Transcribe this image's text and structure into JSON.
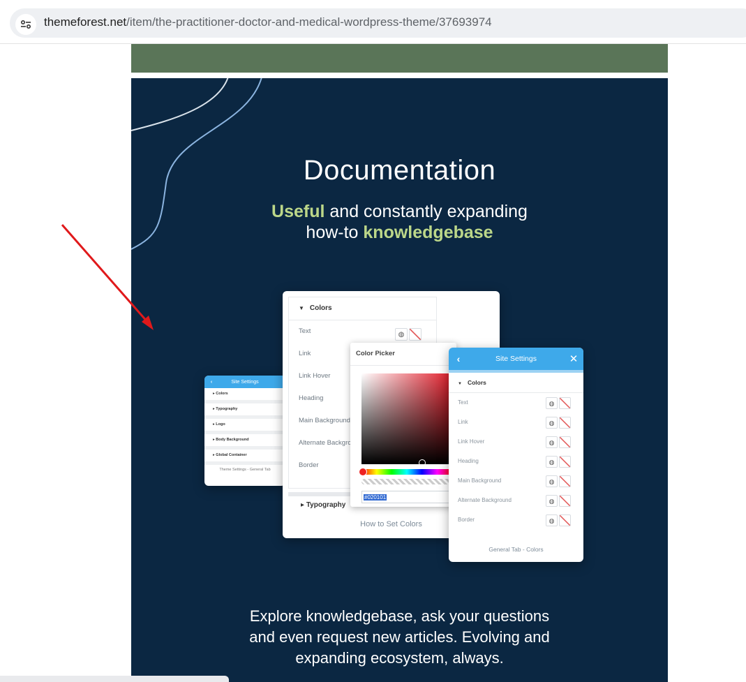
{
  "browser": {
    "url_domain": "themeforest.net",
    "url_path": "/item/the-practitioner-doctor-and-medical-wordpress-theme/37693974",
    "site_icon": "tune-icon"
  },
  "hero": {
    "title": "Documentation",
    "subtitle_hl1": "Useful",
    "subtitle_mid": " and constantly expanding",
    "subtitle_prefix2": "how-to ",
    "subtitle_hl2": "knowledgebase",
    "body_line1": "Explore knowledgebase, ask your questions",
    "body_line2": "and even request new articles. Evolving and",
    "body_line3": "expanding ecosystem, always."
  },
  "small_card": {
    "title": "Site Settings",
    "items": [
      "Colors",
      "Typography",
      "Logo",
      "Body Background",
      "Global Container"
    ],
    "footer": "Theme Settings - General Tab"
  },
  "main_card": {
    "section": "Colors",
    "options": [
      "Text",
      "Link",
      "Link Hover",
      "Heading",
      "Main Background",
      "Alternate Backgro",
      "Border"
    ],
    "typography": "Typography",
    "footer": "How to Set Colors"
  },
  "picker": {
    "title": "Color Picker",
    "hex_value": "#020101"
  },
  "site_card": {
    "title": "Site Settings",
    "section": "Colors",
    "options": [
      "Text",
      "Link",
      "Link Hover",
      "Heading",
      "Main Background",
      "Alternate Background",
      "Border"
    ],
    "footer": "General Tab - Colors"
  },
  "colors": {
    "hero_bg": "#0b2742",
    "accent_green": "#bcd789",
    "header_blue": "#3ea9ea",
    "top_band": "#5a7558",
    "annotation_arrow": "#e0191b"
  }
}
